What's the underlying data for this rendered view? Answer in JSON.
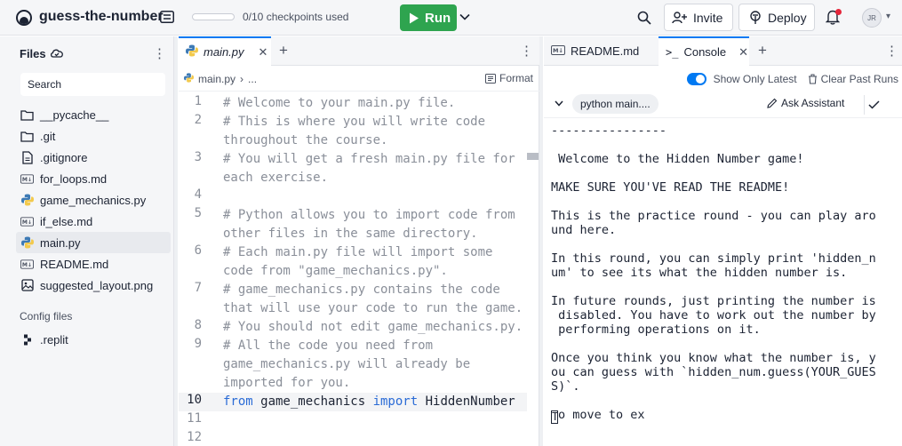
{
  "header": {
    "app_name": "guess-the-number",
    "checkpoints": "0/10 checkpoints used",
    "checkpoints_progress": 0,
    "run_label": "Run",
    "invite_label": "Invite",
    "deploy_label": "Deploy",
    "avatar_initials": "JR",
    "colors": {
      "run": "#2ea44f",
      "accent": "#0079f2",
      "notify_dot": "#e5253a"
    }
  },
  "sidebar": {
    "title": "Files",
    "search_placeholder": "Search",
    "files": [
      {
        "name": "__pycache__",
        "icon": "folder-icon"
      },
      {
        "name": ".git",
        "icon": "folder-icon"
      },
      {
        "name": ".gitignore",
        "icon": "file-icon"
      },
      {
        "name": "for_loops.md",
        "icon": "markdown-icon"
      },
      {
        "name": "game_mechanics.py",
        "icon": "python-icon"
      },
      {
        "name": "if_else.md",
        "icon": "markdown-icon"
      },
      {
        "name": "main.py",
        "icon": "python-icon",
        "active": true
      },
      {
        "name": "README.md",
        "icon": "markdown-icon"
      },
      {
        "name": "suggested_layout.png",
        "icon": "image-icon"
      }
    ],
    "config_title": "Config files",
    "config_files": [
      {
        "name": ".replit",
        "icon": "replit-config-icon"
      }
    ]
  },
  "editor": {
    "tab_label": "main.py",
    "breadcrumb_file": "main.py",
    "breadcrumb_more": "...",
    "format_label": "Format",
    "lines": [
      {
        "n": "1",
        "text": "# Welcome to your main.py file."
      },
      {
        "n": "2",
        "text": "# This is where you will write code throughout the course."
      },
      {
        "n": "3",
        "text": "# You will get a fresh main.py file for each exercise."
      },
      {
        "n": "4",
        "text": ""
      },
      {
        "n": "5",
        "text": "# Python allows you to import code from other files in the same directory."
      },
      {
        "n": "6",
        "text": "# Each main.py file will import some code from \"game_mechanics.py\"."
      },
      {
        "n": "7",
        "text": "# game_mechanics.py contains the code that will use your code to run the game."
      },
      {
        "n": "8",
        "text": "# You should not edit game_mechanics.py."
      },
      {
        "n": "9",
        "text": "# All the code you need from game_mechanics.py will already be imported for you."
      },
      {
        "n": "10",
        "kw1": "from",
        "mid": " game_mechanics ",
        "kw2": "import",
        "tail": " HiddenNumber"
      },
      {
        "n": "11",
        "text": ""
      },
      {
        "n": "12",
        "text": ""
      }
    ]
  },
  "right": {
    "readme_tab": "README.md",
    "console_tab": "Console",
    "show_only_latest": "Show Only Latest",
    "clear_past_runs": "Clear Past Runs",
    "command": "python main....",
    "ask_assistant": "Ask Assistant",
    "output": [
      "----------------",
      "",
      " Welcome to the Hidden Number game!",
      "",
      "MAKE SURE YOU'VE READ THE README!",
      "",
      "This is the practice round - you can play aro",
      "und here.",
      "",
      "In this round, you can simply print 'hidden_n",
      "um' to see its what the hidden number is.",
      "",
      "In future rounds, just printing the number is",
      " disabled. You have to work out the number by",
      " performing operations on it.",
      "",
      "Once you think you know what the number is, y",
      "ou can guess with `hidden_num.guess(YOUR_GUES",
      "S)`.",
      ""
    ],
    "last_line": "o move to ex",
    "cursor_char": "T"
  }
}
